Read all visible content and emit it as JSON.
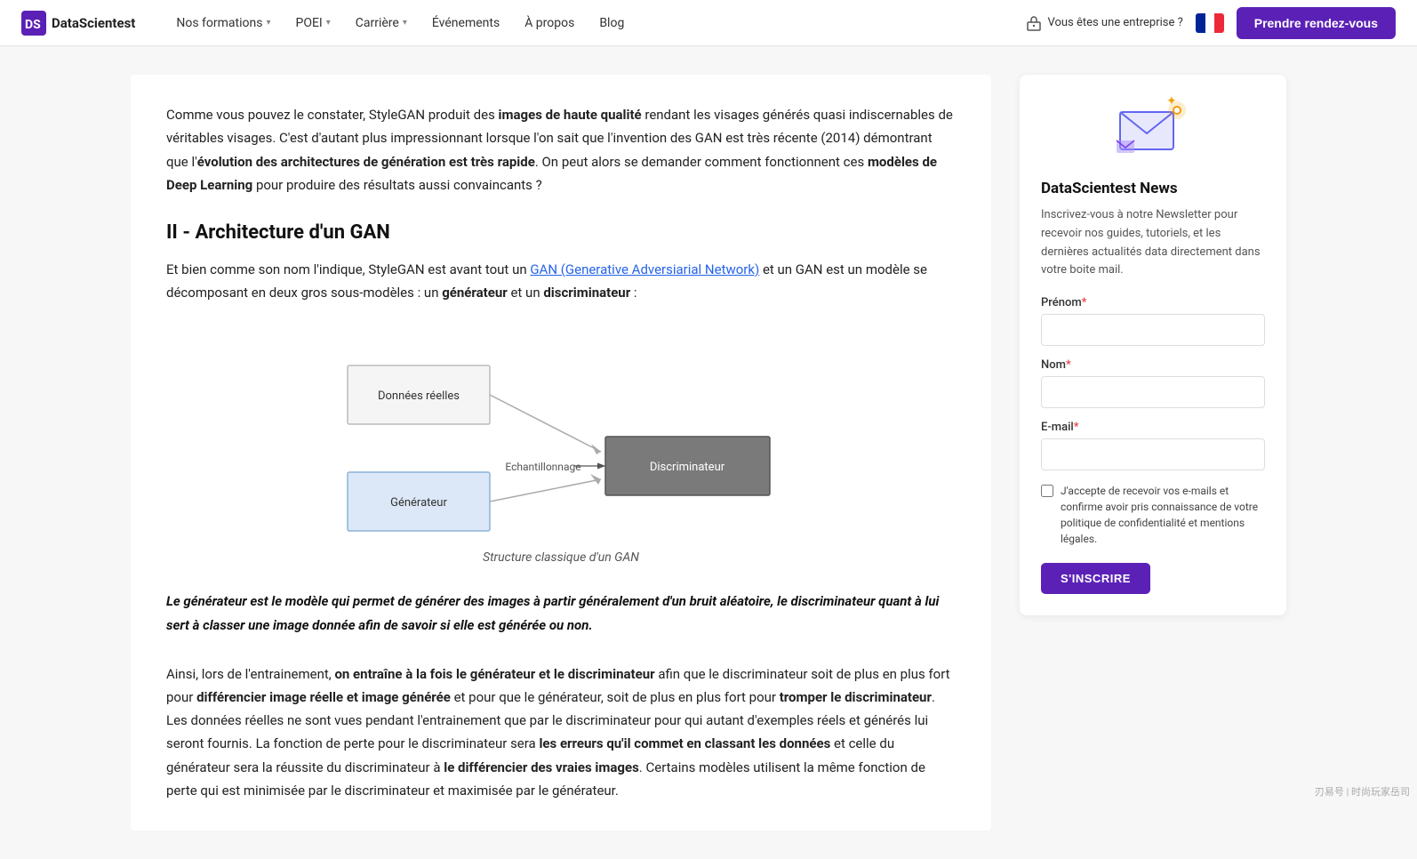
{
  "nav": {
    "logo_text": "DataScientest",
    "links": [
      {
        "label": "Nos formations",
        "has_dropdown": true
      },
      {
        "label": "POEI",
        "has_dropdown": true
      },
      {
        "label": "Carrière",
        "has_dropdown": true
      },
      {
        "label": "Événements",
        "has_dropdown": false
      },
      {
        "label": "À propos",
        "has_dropdown": false
      },
      {
        "label": "Blog",
        "has_dropdown": false
      }
    ],
    "enterprise_label": "Vous êtes une entreprise ?",
    "cta_label": "Prendre rendez-vous"
  },
  "main": {
    "intro": {
      "part1": "Comme vous pouvez le constater, StyleGAN produit des ",
      "bold1": "images de haute qualité",
      "part2": " rendant les visages générés quasi indiscernables de véritables visages. C'est d'autant plus impressionnant lorsque l'on sait que l'invention des GAN est très récente (2014) démontrant que l'",
      "bold2": "évolution des architectures de génération est très rapide",
      "part3": ". On peut alors se demander comment fonctionnent ces ",
      "bold3": "modèles de Deep Learning",
      "part4": " pour produire des résultats aussi convaincants ?"
    },
    "section_title": "II - Architecture d'un GAN",
    "body1": {
      "part1": "Et bien comme son nom l'indique, StyleGAN est avant tout un ",
      "link_text": "GAN (Generative Adversiarial Network)",
      "part2": " et un GAN est un modèle se décomposant en deux gros sous-modèles : un ",
      "bold1": "générateur",
      "part3": " et un ",
      "bold2": "discriminateur",
      "part4": " :"
    },
    "diagram": {
      "caption": "Structure classique d'un GAN",
      "box_donnees": "Données réelles",
      "box_generateur": "Générateur",
      "box_discriminateur": "Discriminateur",
      "label_echantillonnage": "Echantillonnage"
    },
    "quote": "Le générateur est le modèle qui permet de générer des images à partir généralement d'un bruit aléatoire, le discriminateur quant à lui sert à classer une image donnée afin de savoir si elle est générée ou non.",
    "bottom_text": {
      "part1": "Ainsi, lors de l'entrainement, ",
      "bold1": "on entraîne à la fois le générateur et le discriminateur",
      "part2": " afin que le discriminateur soit de plus en plus fort pour ",
      "bold2": "différencier image réelle et image générée",
      "part3": " et pour que le générateur, soit de plus en plus fort pour ",
      "bold3": "tromper le discriminateur",
      "part4": ". Les données réelles ne sont vues pendant l'entrainement que par le discriminateur pour qui autant d'exemples réels et générés lui seront fournis. La fonction de perte pour le discriminateur sera ",
      "bold4": "les erreurs qu'il commet en classant les données",
      "part5": " et celle du générateur sera la réussite du discriminateur à ",
      "bold5": "le différencier des vraies images",
      "part6": ". Certains modèles utilisent la même fonction de perte qui est minimisée par le discriminateur et maximisée par le générateur."
    }
  },
  "sidebar": {
    "newsletter": {
      "title": "DataScientest News",
      "description": "Inscrivez-vous à notre Newsletter pour recevoir nos guides, tutoriels, et les dernières actualités data directement dans votre boite mail.",
      "prenom_label": "Prénom",
      "prenom_required": true,
      "nom_label": "Nom",
      "nom_required": true,
      "email_label": "E-mail",
      "email_required": true,
      "checkbox_text": "J'accepte de recevoir vos e-mails et confirme avoir pris connaissance de votre politique de confidentialité et mentions légales.",
      "subscribe_btn": "S'INSCRIRE"
    }
  },
  "watermark": "刃易号 | 时尚玩家岳司"
}
